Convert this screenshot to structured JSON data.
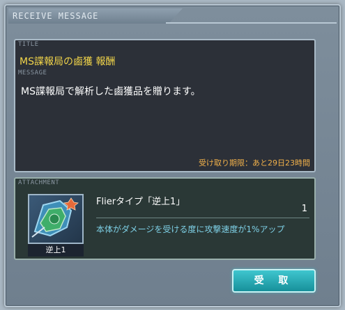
{
  "dialog": {
    "header_title": "RECEIVE MESSAGE"
  },
  "message": {
    "title_label": "TITLE",
    "title": "MS諜報局の鹵獲 報酬",
    "message_label": "MESSAGE",
    "body": "MS諜報局で解析した鹵獲品を贈ります。",
    "deadline": "受け取り期限：あと29日23時間"
  },
  "attachment": {
    "label": "ATTACHMENT",
    "item_icon_name": "逆上1",
    "item_name": "Flierタイプ「逆上1」",
    "quantity": "1",
    "description": "本体がダメージを受ける度に攻撃速度が1%アップ"
  },
  "actions": {
    "receive_label": "受 取"
  },
  "colors": {
    "title_yellow": "#f2d54a",
    "deadline_orange": "#f0b04a",
    "desc_cyan": "#7ed0e6",
    "button_teal": "#17909a"
  }
}
